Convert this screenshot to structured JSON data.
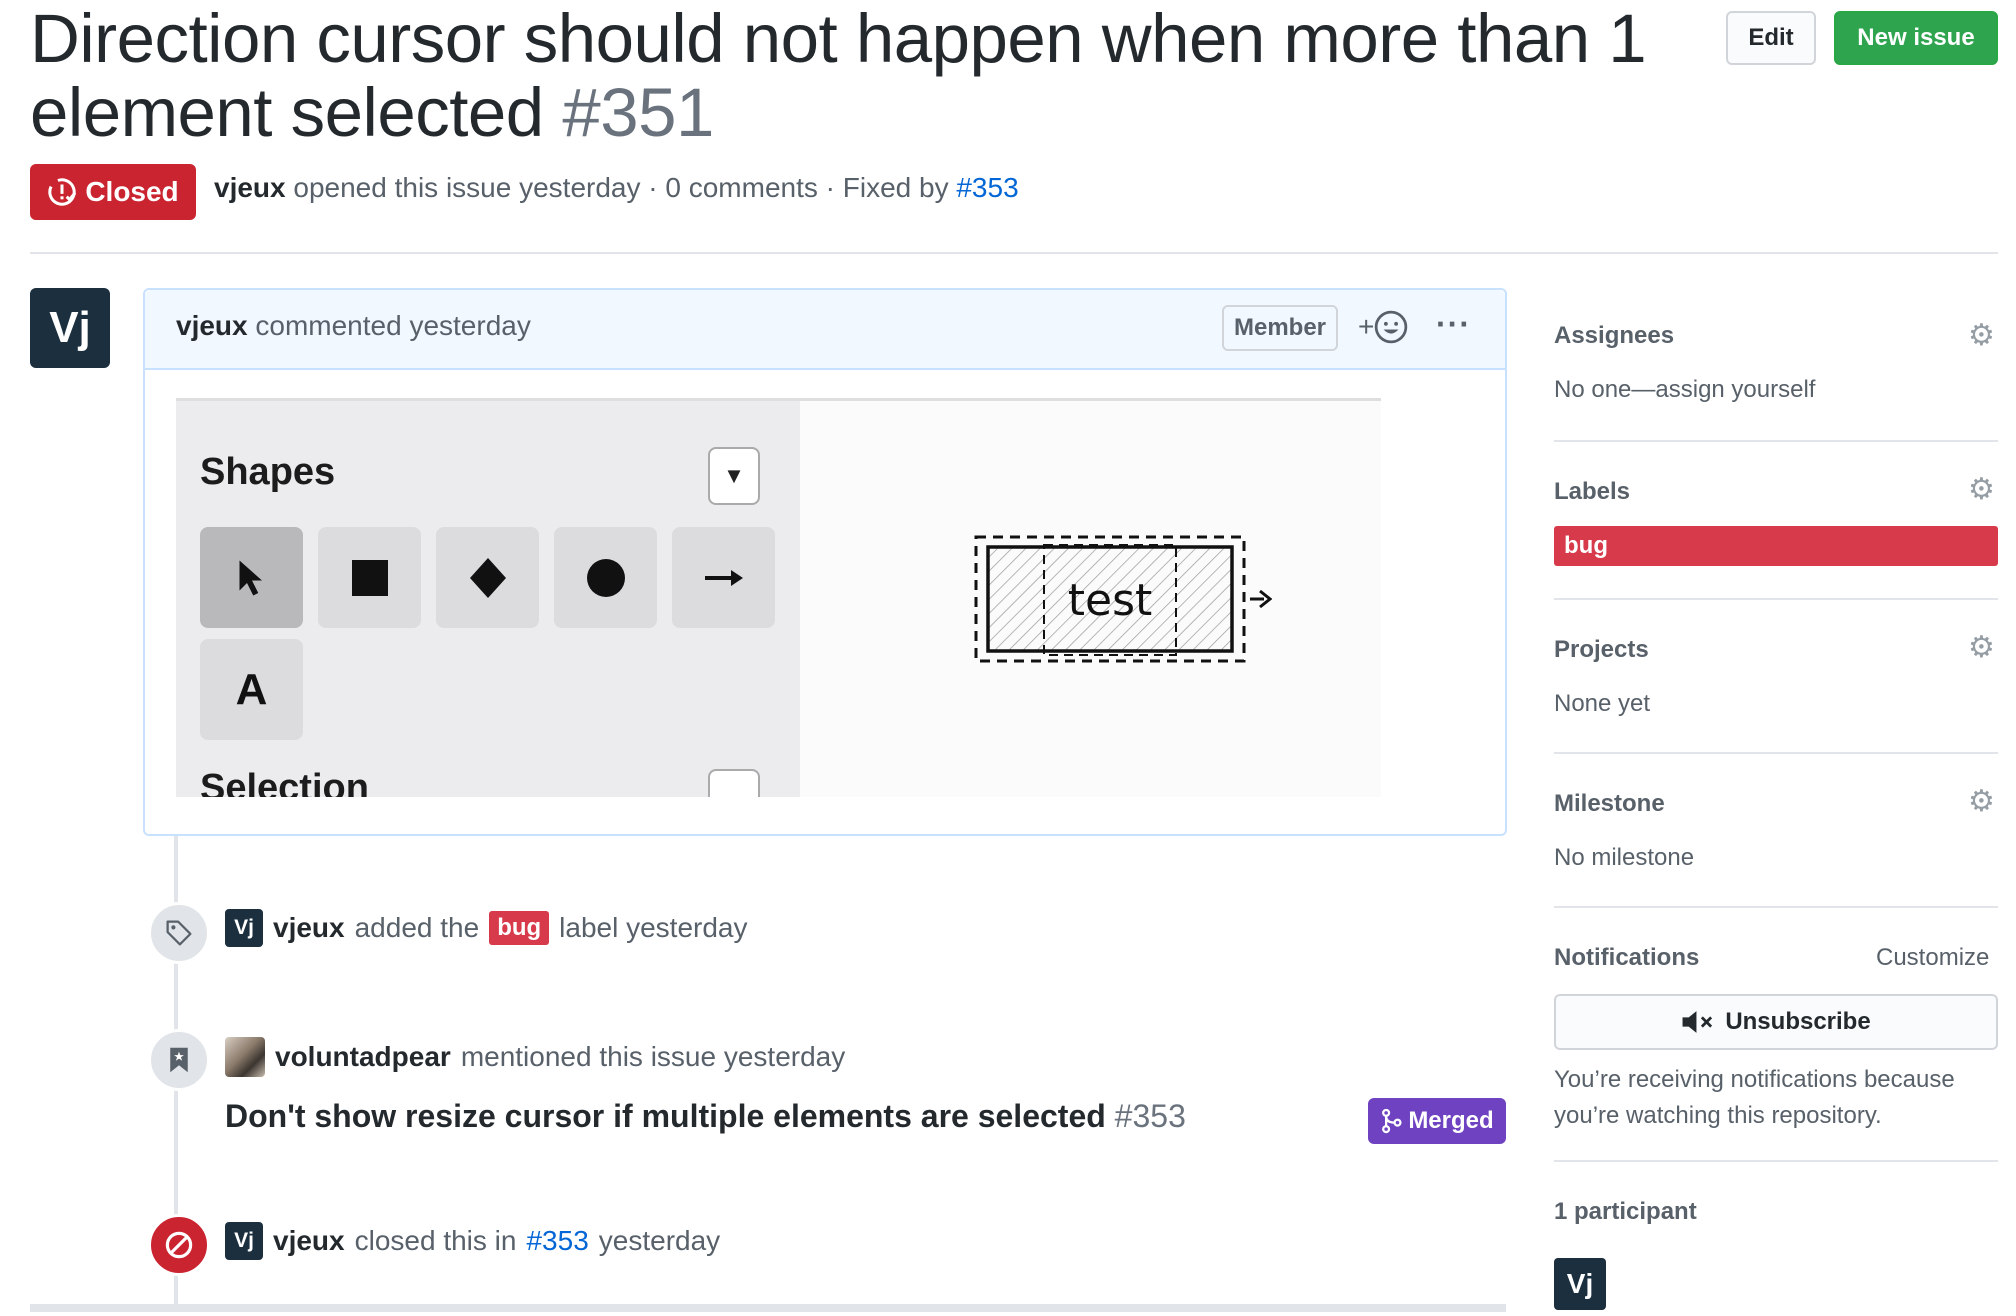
{
  "issue": {
    "title": "Direction cursor should not happen when more than 1 element selected",
    "number": "#351",
    "state": "Closed",
    "author": "vjeux",
    "opened_text": "opened this issue yesterday · 0 comments · Fixed by",
    "fixed_by": "#353"
  },
  "header_buttons": {
    "edit": "Edit",
    "new_issue": "New issue"
  },
  "comment": {
    "avatar_initials": "Vj",
    "author": "vjeux",
    "action": "commented yesterday",
    "role_badge": "Member",
    "reaction_plus": "+",
    "more": "···",
    "screenshot": {
      "panel_title": "Shapes",
      "dropdown_glyph": "▼",
      "tools": [
        "pointer-icon",
        "square-icon",
        "diamond-icon",
        "circle-icon",
        "arrow-icon",
        "text-icon"
      ],
      "text_tool_label": "A",
      "next_section": "Selection",
      "canvas_text": "test"
    }
  },
  "timeline": {
    "labeled": {
      "avatar": "Vj",
      "actor": "vjeux",
      "pre": "added the",
      "label": "bug",
      "post": "label yesterday"
    },
    "mentioned": {
      "actor": "voluntadpear",
      "text": "mentioned this issue yesterday",
      "pr_title": "Don't show resize cursor if multiple elements are selected",
      "pr_number": "#353",
      "pr_state": "Merged"
    },
    "closed": {
      "avatar": "Vj",
      "actor": "vjeux",
      "pre": "closed this in",
      "ref": "#353",
      "post": "yesterday"
    }
  },
  "sidebar": {
    "assignees": {
      "title": "Assignees",
      "value": "No one—assign yourself"
    },
    "labels": {
      "title": "Labels",
      "value": "bug"
    },
    "projects": {
      "title": "Projects",
      "value": "None yet"
    },
    "milestone": {
      "title": "Milestone",
      "value": "No milestone"
    },
    "notifications": {
      "title": "Notifications",
      "customize": "Customize",
      "button": "Unsubscribe",
      "reason": "You’re receiving notifications because you’re watching this repository."
    },
    "participants": {
      "title": "1 participant",
      "avatar": "Vj"
    }
  },
  "colors": {
    "closed": "#cb2431",
    "primary": "#2ea44f",
    "link": "#0366d6",
    "bug_label": "#d73a4a",
    "merged": "#6f42c1",
    "avatar_bg": "#1b2f3f"
  }
}
